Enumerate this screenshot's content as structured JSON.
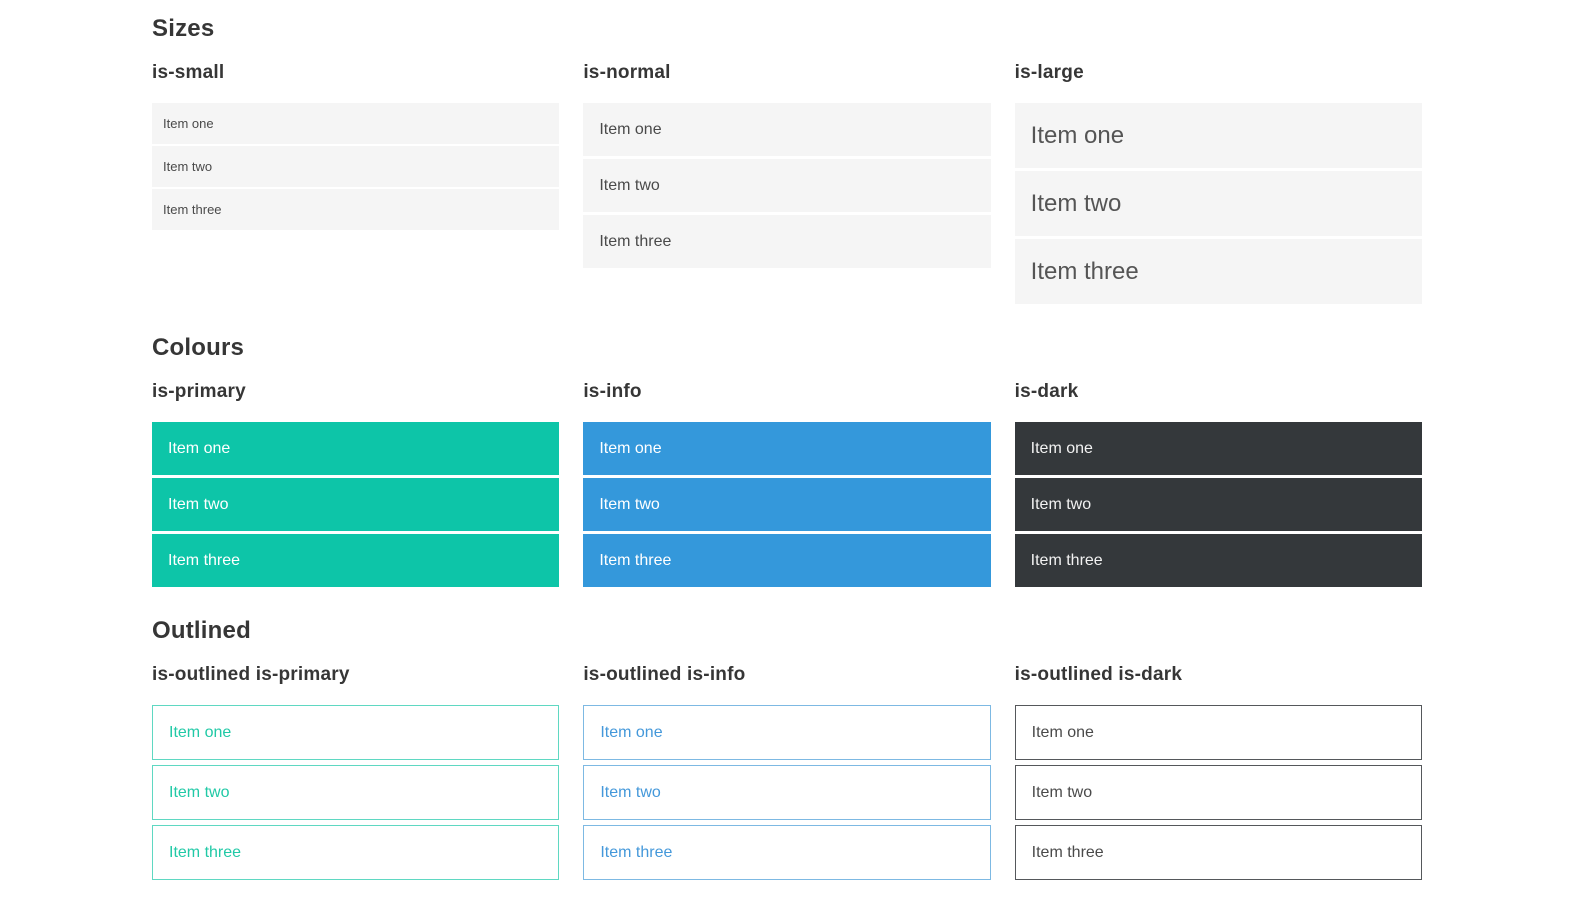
{
  "sections": [
    {
      "title": "Sizes",
      "groups": [
        {
          "heading": "is-small",
          "items": [
            "Item one",
            "Item two",
            "Item three"
          ]
        },
        {
          "heading": "is-normal",
          "items": [
            "Item one",
            "Item two",
            "Item three"
          ]
        },
        {
          "heading": "is-large",
          "items": [
            "Item one",
            "Item two",
            "Item three"
          ]
        }
      ]
    },
    {
      "title": "Colours",
      "groups": [
        {
          "heading": "is-primary",
          "items": [
            "Item one",
            "Item two",
            "Item three"
          ]
        },
        {
          "heading": "is-info",
          "items": [
            "Item one",
            "Item two",
            "Item three"
          ]
        },
        {
          "heading": "is-dark",
          "items": [
            "Item one",
            "Item two",
            "Item three"
          ]
        }
      ]
    },
    {
      "title": "Outlined",
      "groups": [
        {
          "heading": "is-outlined is-primary",
          "items": [
            "Item one",
            "Item two",
            "Item three"
          ]
        },
        {
          "heading": "is-outlined is-info",
          "items": [
            "Item one",
            "Item two",
            "Item three"
          ]
        },
        {
          "heading": "is-outlined is-dark",
          "items": [
            "Item one",
            "Item two",
            "Item three"
          ]
        }
      ]
    }
  ],
  "colors": {
    "primary": "#0dc5a8",
    "info": "#3498db",
    "dark": "#34383b",
    "item_background": "#f5f5f5",
    "heading_text": "#363636",
    "body_text": "#4a4a4a",
    "outlined_primary_border": "#5fd8c2",
    "outlined_info_border": "#7db9e3",
    "outlined_dark_border": "#55585b"
  }
}
